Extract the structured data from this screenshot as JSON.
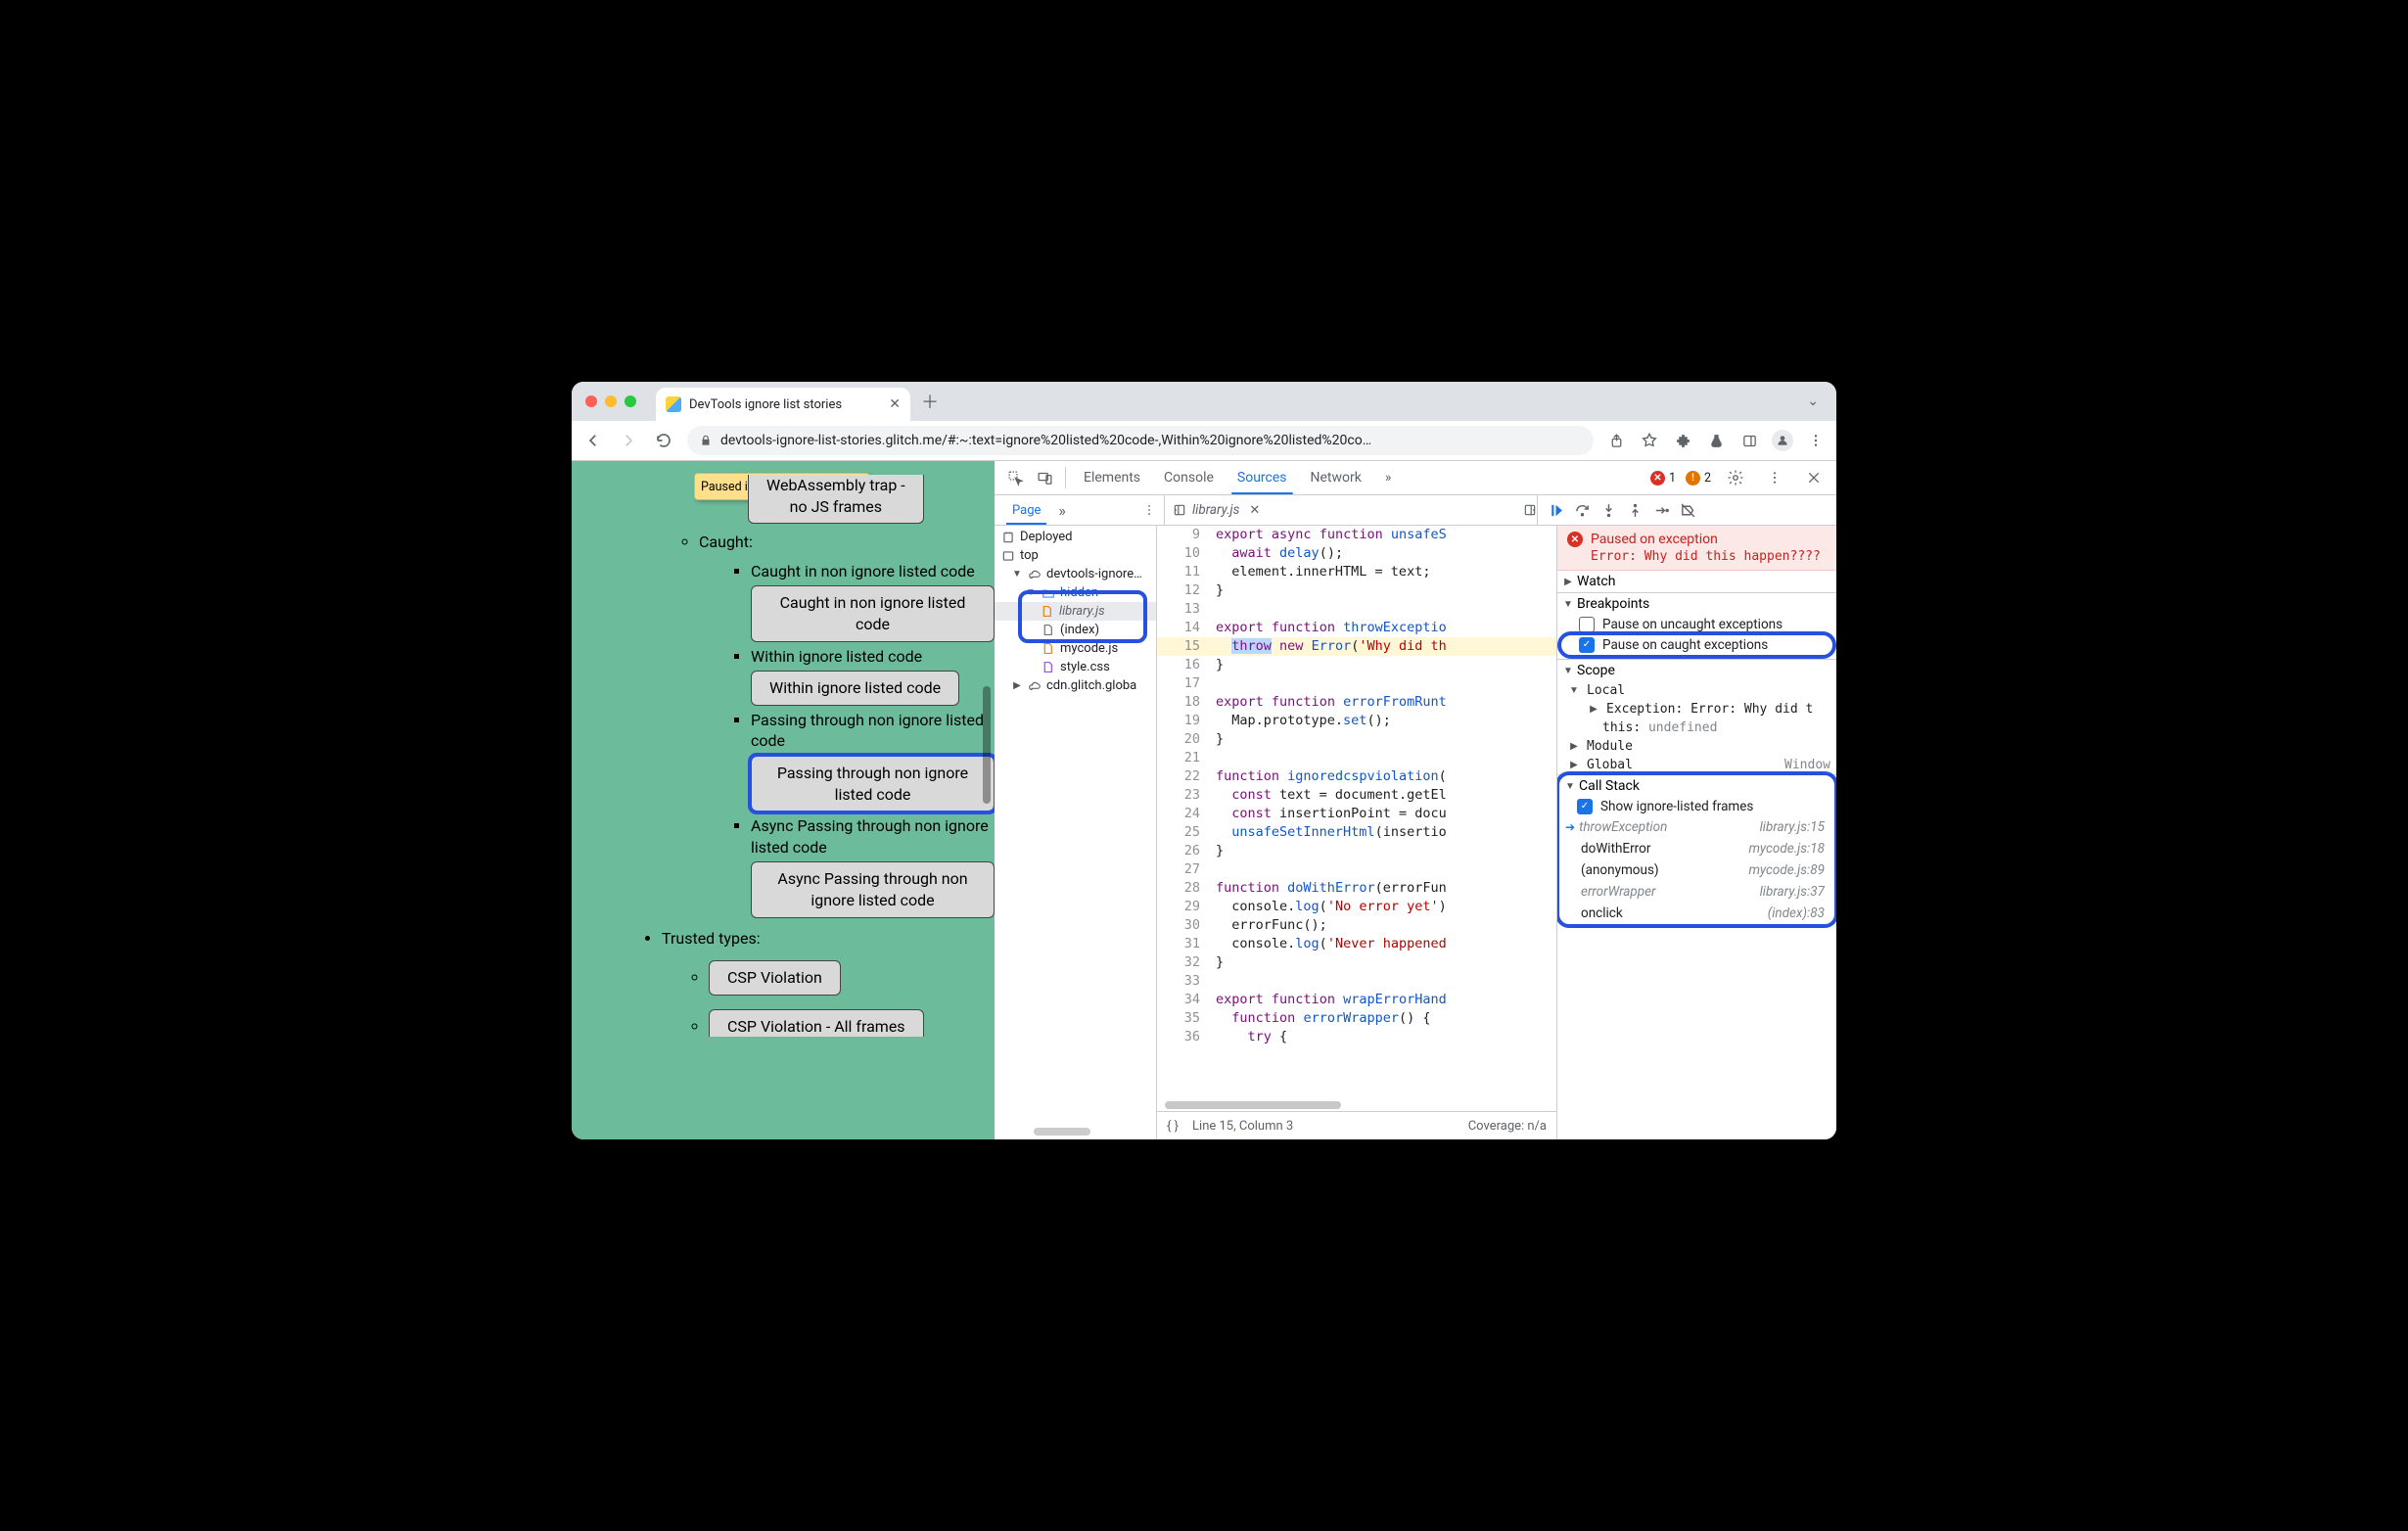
{
  "browser": {
    "tab_title": "DevTools ignore list stories",
    "url": "devtools-ignore-list-stories.glitch.me/#:~:text=ignore%20listed%20code-,Within%20ignore%20listed%20co…"
  },
  "paused_badge": {
    "label": "Paused in debugger"
  },
  "page": {
    "top_button_line1": "WebAssembly trap -",
    "top_button_line2": "no JS frames",
    "caught_label": "Caught:",
    "items": [
      {
        "label": "Caught in non ignore listed code",
        "button": "Caught in non ignore listed code"
      },
      {
        "label": "Within ignore listed code",
        "button": "Within ignore listed code"
      },
      {
        "label": "Passing through non ignore listed code",
        "button": "Passing through non ignore listed code",
        "highlight": true
      },
      {
        "label": "Async Passing through non ignore listed code",
        "button": "Async Passing through non ignore listed code"
      }
    ],
    "trusted_label": "Trusted types:",
    "trusted_items": [
      {
        "button": "CSP Violation"
      },
      {
        "button": "CSP Violation - All frames"
      }
    ]
  },
  "devtools": {
    "tabs": {
      "elements": "Elements",
      "console": "Console",
      "sources": "Sources",
      "network": "Network"
    },
    "errors": "1",
    "warnings": "2",
    "nav_tab": "Page",
    "open_file": "library.js",
    "tree": {
      "deployed": "Deployed",
      "top": "top",
      "site": "devtools-ignore…",
      "hidden": "hidden",
      "library": "library.js",
      "index": "(index)",
      "mycode": "mycode.js",
      "style": "style.css",
      "cdn": "cdn.glitch.globa"
    },
    "debugbar_title": "Debugger controls"
  },
  "code": {
    "lines": [
      {
        "n": 9,
        "t": "export async function unsafeS"
      },
      {
        "n": 10,
        "t": "  await delay();"
      },
      {
        "n": 11,
        "t": "  element.innerHTML = text;"
      },
      {
        "n": 12,
        "t": "}"
      },
      {
        "n": 13,
        "t": ""
      },
      {
        "n": 14,
        "t": "export function throwExceptio"
      },
      {
        "n": 15,
        "t": "  throw new Error('Why did th",
        "hl": true
      },
      {
        "n": 16,
        "t": "}"
      },
      {
        "n": 17,
        "t": ""
      },
      {
        "n": 18,
        "t": "export function errorFromRunt"
      },
      {
        "n": 19,
        "t": "  Map.prototype.set();"
      },
      {
        "n": 20,
        "t": "}"
      },
      {
        "n": 21,
        "t": ""
      },
      {
        "n": 22,
        "t": "function ignoredcspviolation("
      },
      {
        "n": 23,
        "t": "  const text = document.getEl"
      },
      {
        "n": 24,
        "t": "  const insertionPoint = docu"
      },
      {
        "n": 25,
        "t": "  unsafeSetInnerHtml(insertio"
      },
      {
        "n": 26,
        "t": "}"
      },
      {
        "n": 27,
        "t": ""
      },
      {
        "n": 28,
        "t": "function doWithError(errorFun"
      },
      {
        "n": 29,
        "t": "  console.log('No error yet')"
      },
      {
        "n": 30,
        "t": "  errorFunc();"
      },
      {
        "n": 31,
        "t": "  console.log('Never happened"
      },
      {
        "n": 32,
        "t": "}"
      },
      {
        "n": 33,
        "t": ""
      },
      {
        "n": 34,
        "t": "export function wrapErrorHand"
      },
      {
        "n": 35,
        "t": "  function errorWrapper() {"
      },
      {
        "n": 36,
        "t": "    try {"
      }
    ],
    "status_line": "Line 15, Column 3",
    "coverage": "Coverage: n/a"
  },
  "debugger": {
    "paused_title": "Paused on exception",
    "paused_msg": "Error: Why did this happen????",
    "watch": "Watch",
    "breakpoints": "Breakpoints",
    "bp_uncaught": "Pause on uncaught exceptions",
    "bp_caught": "Pause on caught exceptions",
    "scope": "Scope",
    "scope_local": "Local",
    "scope_exception": "Exception",
    "scope_exception_val": "Error: Why did t",
    "scope_this": "this",
    "scope_this_val": "undefined",
    "scope_module": "Module",
    "scope_global": "Global",
    "scope_global_val": "Window",
    "callstack": "Call Stack",
    "show_ignored": "Show ignore-listed frames",
    "frames": [
      {
        "name": "throwException",
        "loc": "library.js:15",
        "ignored": true,
        "current": true
      },
      {
        "name": "doWithError",
        "loc": "mycode.js:18"
      },
      {
        "name": "(anonymous)",
        "loc": "mycode.js:89"
      },
      {
        "name": "errorWrapper",
        "loc": "library.js:37",
        "ignored": true
      },
      {
        "name": "onclick",
        "loc": "(index):83"
      }
    ]
  }
}
